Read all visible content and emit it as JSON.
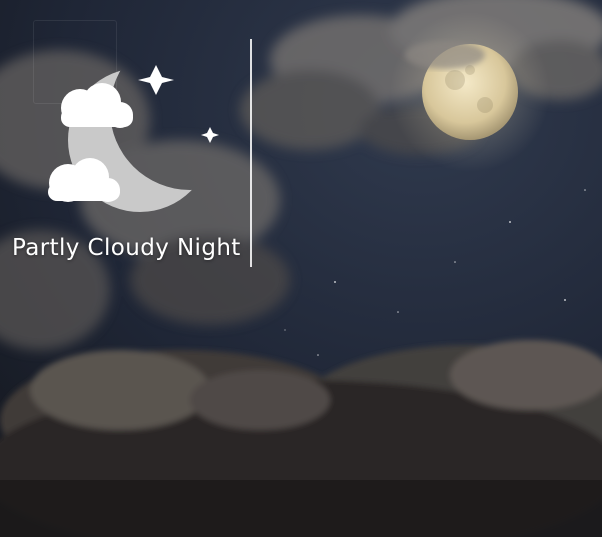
{
  "widget": {
    "condition": "Partly Cloudy Night",
    "icon": "partly-cloudy-night-icon"
  },
  "colors": {
    "icon_fill": "#c9c9c9",
    "cloud_fill": "#ffffff",
    "text": "#ffffff",
    "sky": "#1c2230"
  }
}
